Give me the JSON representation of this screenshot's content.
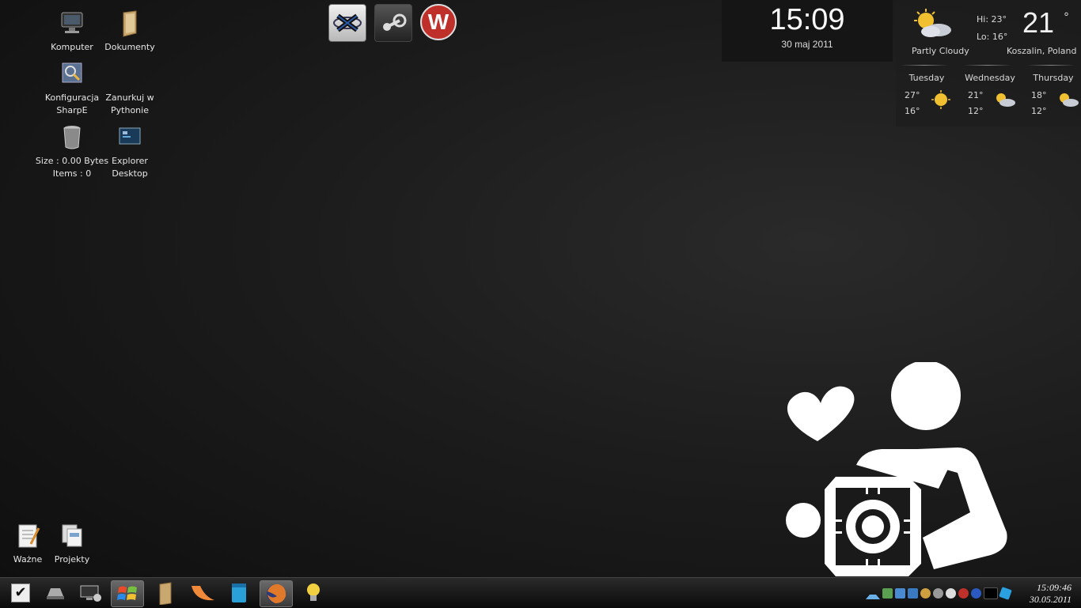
{
  "desktop": {
    "icons": [
      {
        "label": "Komputer"
      },
      {
        "label": "Dokumenty"
      },
      {
        "label": "Konfiguracja\nSharpE"
      },
      {
        "label": "Zanurkuj w\nPythonie"
      },
      {
        "label": "Size : 0.00 Bytes\nItems : 0"
      },
      {
        "label": "Explorer\nDesktop"
      },
      {
        "label": "Ważne"
      },
      {
        "label": "Projekty"
      }
    ]
  },
  "dock": {
    "items": [
      {
        "icon": "xfire-icon"
      },
      {
        "icon": "steam-icon"
      },
      {
        "icon": "w-app-icon",
        "glyph": "W",
        "color": "#c0302a"
      }
    ]
  },
  "clock": {
    "time": "15:09",
    "date": "30 maj 2011"
  },
  "weather": {
    "hi": "Hi: 23°",
    "lo": "Lo: 16°",
    "temp": "21",
    "deg": "°",
    "condition": "Partly Cloudy",
    "location": "Koszalin, Poland",
    "forecast": [
      {
        "day": "Tuesday",
        "hi": "27°",
        "lo": "16°",
        "icon": "sunny-icon"
      },
      {
        "day": "Wednesday",
        "hi": "21°",
        "lo": "12°",
        "icon": "partly-cloudy-icon"
      },
      {
        "day": "Thursday",
        "hi": "18°",
        "lo": "12°",
        "icon": "partly-cloudy-icon"
      }
    ]
  },
  "taskbar": {
    "items": [
      {
        "icon": "checkmark-icon"
      },
      {
        "icon": "drive-icon"
      },
      {
        "icon": "computer-settings-icon"
      },
      {
        "icon": "windows-start-icon"
      },
      {
        "icon": "folder-icon"
      },
      {
        "icon": "orange-slice-icon"
      },
      {
        "icon": "notebook-icon"
      },
      {
        "icon": "firefox-icon"
      },
      {
        "icon": "lightbulb-icon"
      }
    ],
    "tray_icons": [
      "arrow-up-icon",
      "network-icon",
      "monitor-icon",
      "dropbox-icon",
      "globe-icon",
      "disk-icon",
      "steam-tray-icon",
      "w-tray-icon",
      "flash-icon",
      "terminal-icon",
      "diamond-icon"
    ],
    "clock_time": "15:09:46",
    "clock_date": "30.05.2011"
  },
  "colors": {
    "accent_red": "#c0302a",
    "background": "#1c1c1c"
  }
}
